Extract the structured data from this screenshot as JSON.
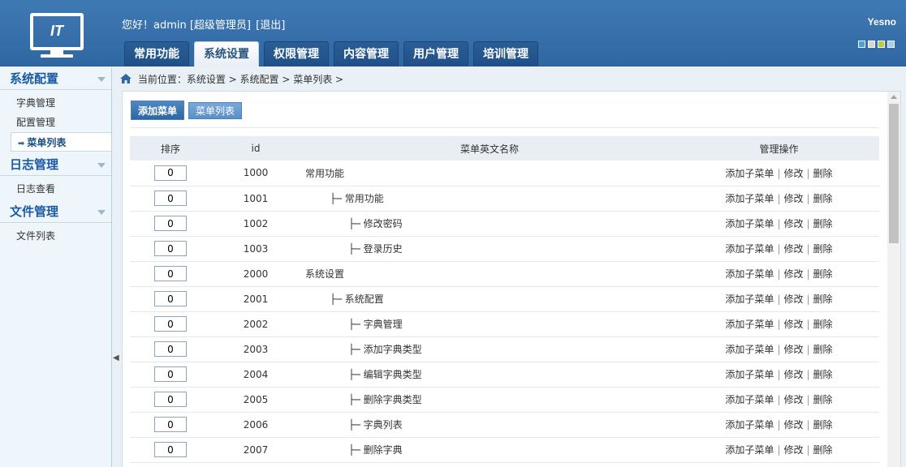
{
  "header": {
    "logo_text": "IT",
    "greeting": "您好！admin [超级管理员]",
    "logout": "[退出]",
    "brand": "Yesno",
    "theme_colors": [
      "#4aa0d8",
      "#d6d6d6",
      "#b7cf3a",
      "#9fd0ee"
    ]
  },
  "nav": {
    "tabs": [
      {
        "label": "常用功能"
      },
      {
        "label": "系统设置"
      },
      {
        "label": "权限管理"
      },
      {
        "label": "内容管理"
      },
      {
        "label": "用户管理"
      },
      {
        "label": "培训管理"
      }
    ],
    "active": "系统设置"
  },
  "sidebar": {
    "groups": [
      {
        "title": "系统配置",
        "items": [
          "字典管理",
          "配置管理",
          "菜单列表"
        ]
      },
      {
        "title": "日志管理",
        "items": [
          "日志查看"
        ]
      },
      {
        "title": "文件管理",
        "items": [
          "文件列表"
        ]
      }
    ],
    "active_item": "菜单列表"
  },
  "breadcrumb": {
    "text": "当前位置：系统设置 > 系统配置 > 菜单列表 >"
  },
  "toolbar": {
    "add_menu": "添加菜单",
    "menu_list": "菜单列表"
  },
  "table": {
    "headers": {
      "sort": "排序",
      "id": "id",
      "name": "菜单英文名称",
      "ops": "管理操作"
    },
    "ops": {
      "add_sub": "添加子菜单",
      "edit": "修改",
      "delete": "删除",
      "sep": "|"
    },
    "rows": [
      {
        "sort": "0",
        "id": "1000",
        "name": "常用功能"
      },
      {
        "sort": "0",
        "id": "1001",
        "name": "        ├─ 常用功能"
      },
      {
        "sort": "0",
        "id": "1002",
        "name": "              ├─ 修改密码"
      },
      {
        "sort": "0",
        "id": "1003",
        "name": "              ├─ 登录历史"
      },
      {
        "sort": "0",
        "id": "2000",
        "name": "系统设置"
      },
      {
        "sort": "0",
        "id": "2001",
        "name": "        ├─ 系统配置"
      },
      {
        "sort": "0",
        "id": "2002",
        "name": "              ├─ 字典管理"
      },
      {
        "sort": "0",
        "id": "2003",
        "name": "              ├─ 添加字典类型"
      },
      {
        "sort": "0",
        "id": "2004",
        "name": "              ├─ 编辑字典类型"
      },
      {
        "sort": "0",
        "id": "2005",
        "name": "              ├─ 删除字典类型"
      },
      {
        "sort": "0",
        "id": "2006",
        "name": "              ├─ 字典列表"
      },
      {
        "sort": "0",
        "id": "2007",
        "name": "              ├─ 删除字典"
      },
      {
        "sort": "",
        "id": "",
        "name": ""
      }
    ]
  }
}
